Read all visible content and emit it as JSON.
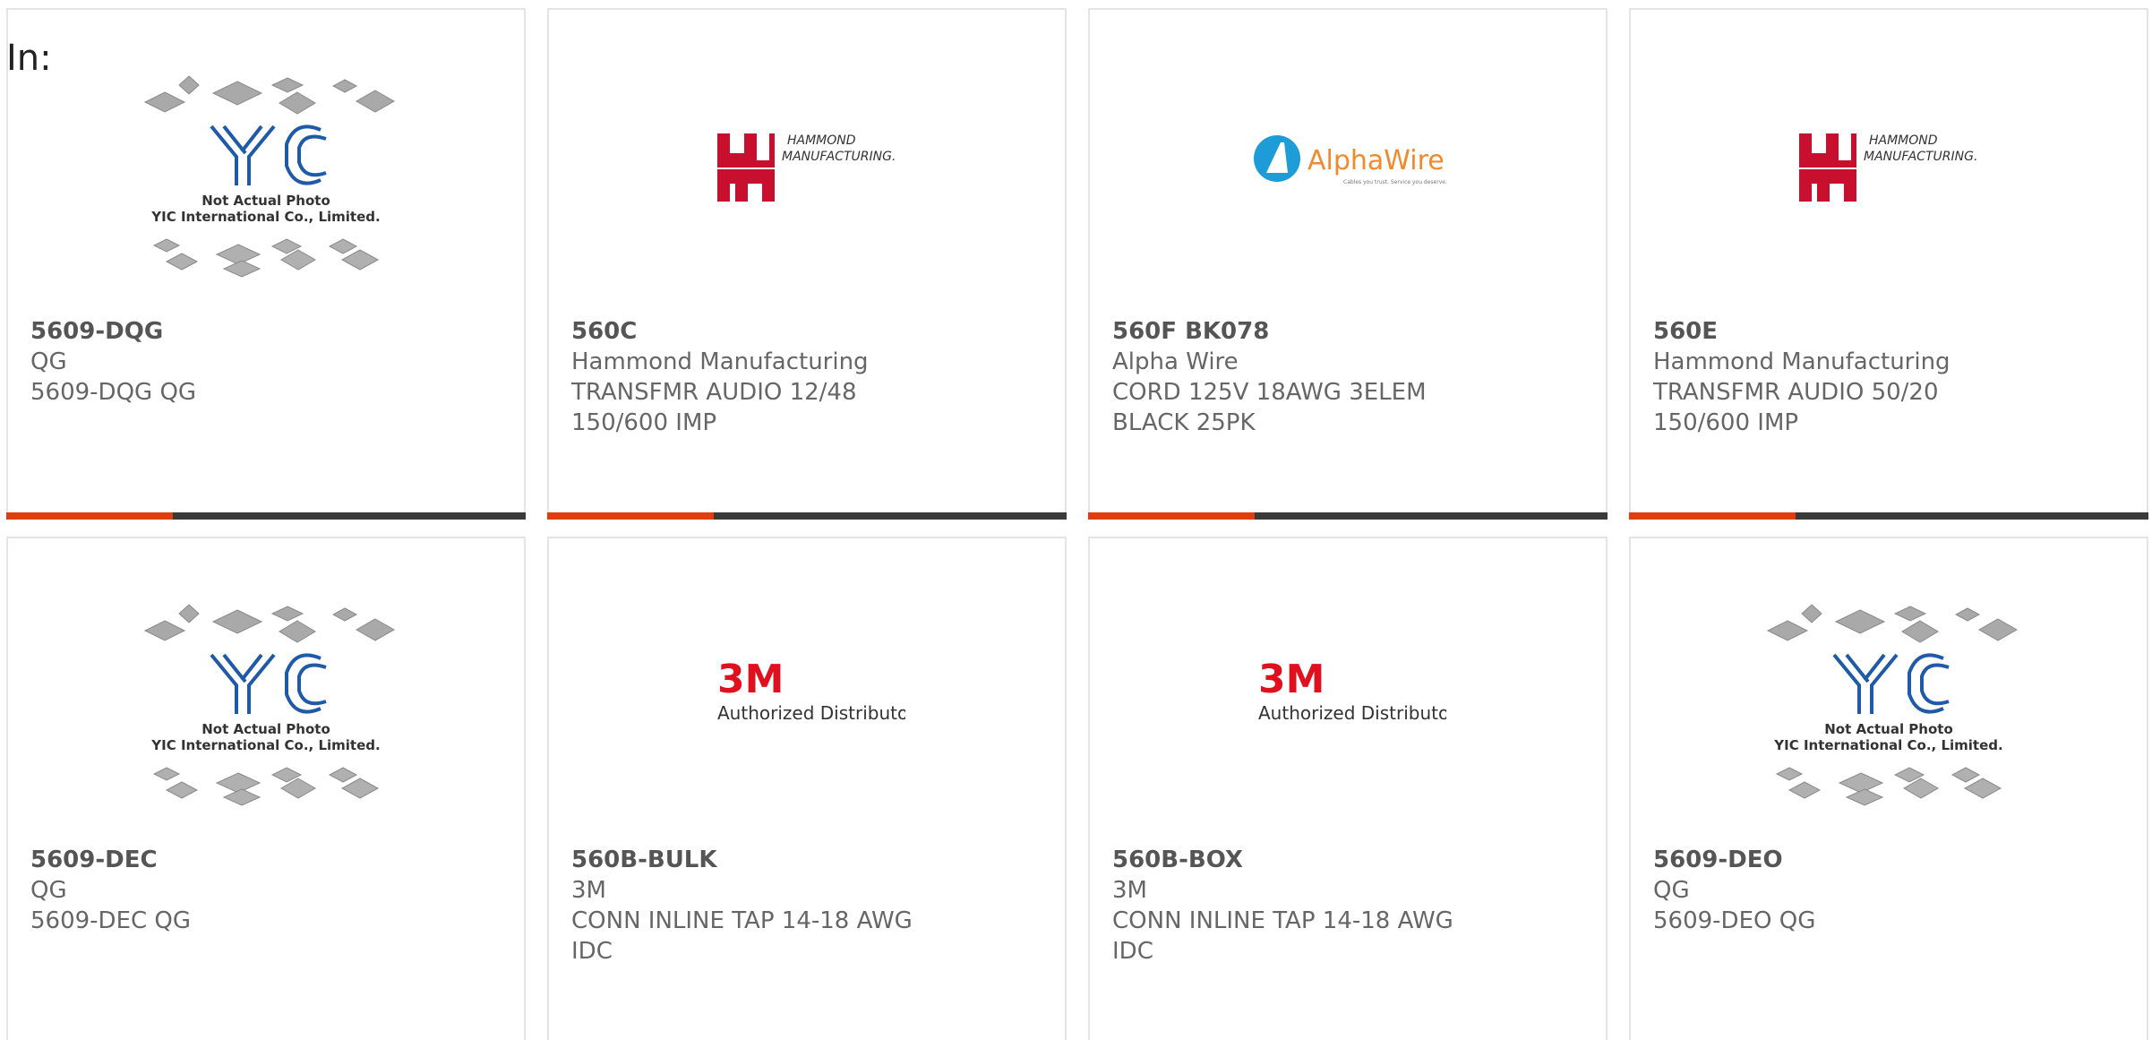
{
  "filter_label": "In:",
  "progress_fraction": 0.32,
  "colors": {
    "accent": "#e03e0f",
    "bar_track": "#3a3a3a",
    "card_border": "#e4e4e4",
    "text": "#666666",
    "hammond_red": "#c8102e",
    "alphawire_blue": "#1e9cd7",
    "alphawire_orange": "#f08a2c",
    "threem_red": "#e0101e"
  },
  "logos": {
    "yic": {
      "brand": "YIC",
      "line1": "Not Actual Photo",
      "line2": "YIC International Co., Limited."
    },
    "hammond": {
      "brand": "HAMMOND",
      "brand2": "MANUFACTURING."
    },
    "alphawire": {
      "brand": "AlphaWire",
      "tagline": "Cables you trust. Service you deserve."
    },
    "threem": {
      "brand": "3M",
      "tagline": "Authorized Distributor"
    }
  },
  "products": [
    {
      "part": "5609-DQG",
      "manufacturer": "QG",
      "description": "5609-DQG QG",
      "logo": "yic"
    },
    {
      "part": "560C",
      "manufacturer": "Hammond Manufacturing",
      "description": "TRANSFMR AUDIO 12/48 150/600 IMP",
      "logo": "hammond"
    },
    {
      "part": "560F BK078",
      "manufacturer": "Alpha Wire",
      "description": "CORD 125V 18AWG 3ELEM BLACK 25PK",
      "logo": "alphawire"
    },
    {
      "part": "560E",
      "manufacturer": "Hammond Manufacturing",
      "description": "TRANSFMR AUDIO 50/20 150/600 IMP",
      "logo": "hammond"
    },
    {
      "part": "5609-DEC",
      "manufacturer": "QG",
      "description": "5609-DEC QG",
      "logo": "yic"
    },
    {
      "part": "560B-BULK",
      "manufacturer": "3M",
      "description": "CONN INLINE TAP 14-18 AWG IDC",
      "logo": "threem"
    },
    {
      "part": "560B-BOX",
      "manufacturer": "3M",
      "description": "CONN INLINE TAP 14-18 AWG IDC",
      "logo": "threem"
    },
    {
      "part": "5609-DEO",
      "manufacturer": "QG",
      "description": "5609-DEO QG",
      "logo": "yic"
    }
  ]
}
